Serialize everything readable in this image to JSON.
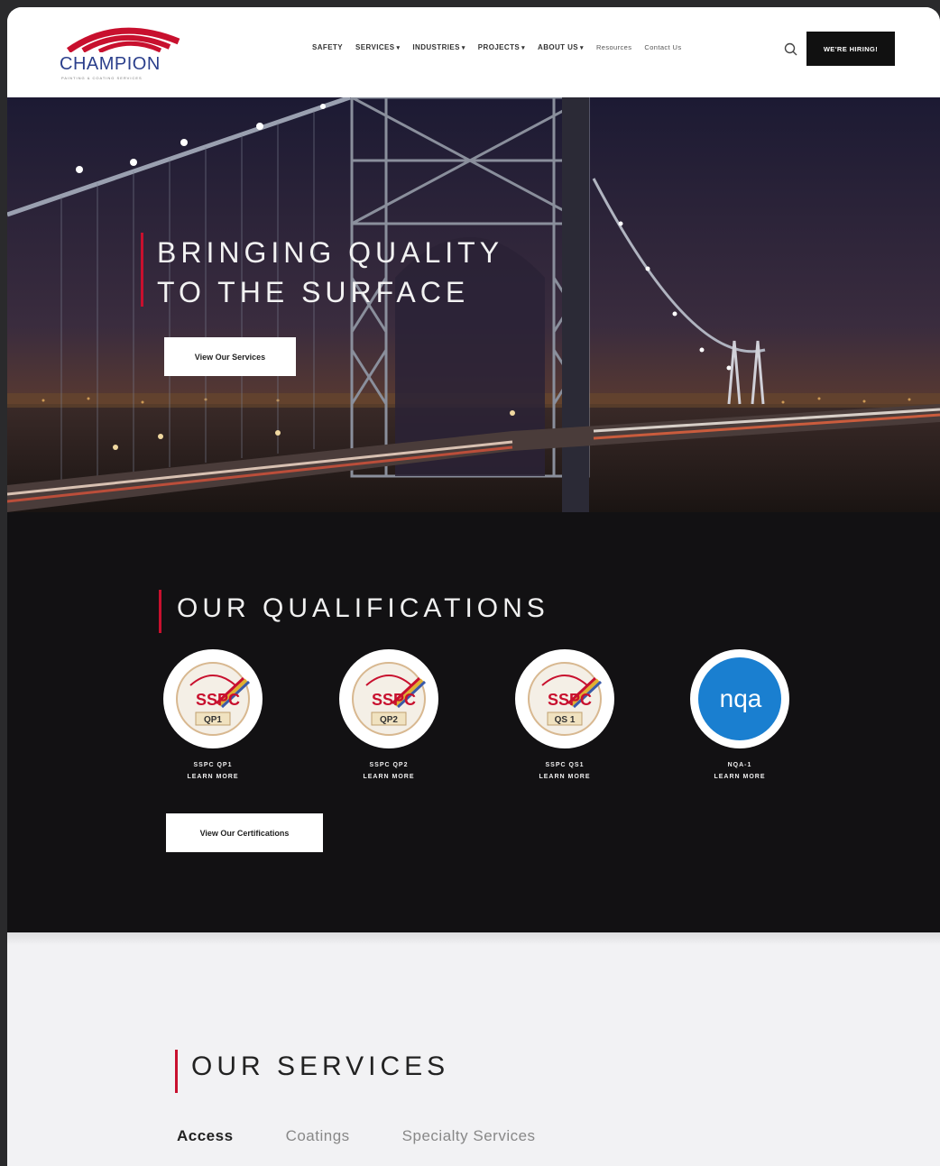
{
  "brand": {
    "name": "CHAMPION",
    "tagline": "PAINTING & COATING SERVICES",
    "accent_color": "#c8102e",
    "logo_color": "#2b3f8c"
  },
  "nav": {
    "items": [
      {
        "label": "Safety",
        "has_dropdown": false
      },
      {
        "label": "Services",
        "has_dropdown": true
      },
      {
        "label": "Industries",
        "has_dropdown": true
      },
      {
        "label": "Projects",
        "has_dropdown": true
      },
      {
        "label": "About Us",
        "has_dropdown": true
      },
      {
        "label": "Resources",
        "has_dropdown": false
      },
      {
        "label": "Contact Us",
        "has_dropdown": false
      }
    ],
    "search_icon": "search-icon",
    "cta": "WE'RE HIRING!"
  },
  "hero": {
    "title_line1": "BRINGING QUALITY",
    "title_line2": "TO THE SURFACE",
    "button": "View Our Services"
  },
  "qualifications": {
    "title": "OUR QUALIFICATIONS",
    "badges": [
      {
        "name": "SSPC QP1",
        "code": "QP1",
        "mark": "SSPC",
        "link": "LEARN MORE"
      },
      {
        "name": "SSPC QP2",
        "code": "QP2",
        "mark": "SSPC",
        "link": "LEARN MORE"
      },
      {
        "name": "SSPC QS1",
        "code": "QS 1",
        "mark": "SSPC",
        "link": "LEARN MORE"
      },
      {
        "name": "NQA-1",
        "code": "nqa",
        "mark": "nqa",
        "link": "LEARN MORE"
      }
    ],
    "button": "View Our Certifications"
  },
  "services": {
    "title": "OUR SERVICES",
    "tabs": [
      {
        "label": "Access",
        "active": true
      },
      {
        "label": "Coatings",
        "active": false
      },
      {
        "label": "Specialty Services",
        "active": false
      }
    ]
  }
}
